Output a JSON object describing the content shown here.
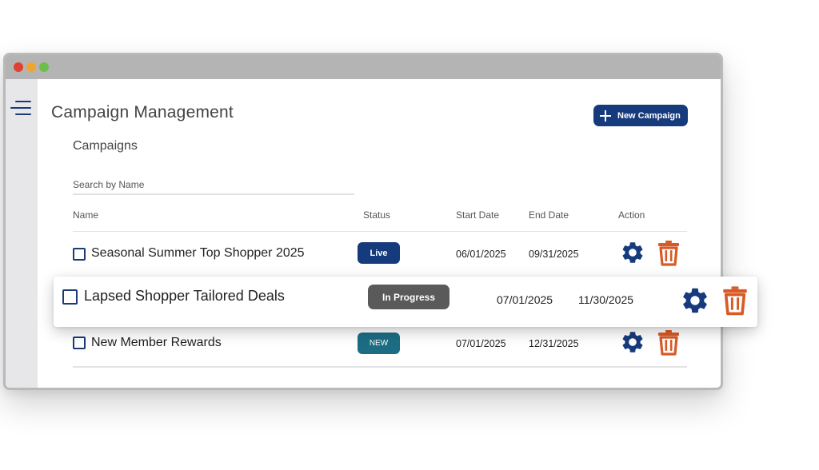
{
  "window": {
    "dots": [
      "#e0402f",
      "#f0a531",
      "#6cc04a"
    ]
  },
  "header": {
    "title": "Campaign Management",
    "new_button_label": "New Campaign"
  },
  "campaigns": {
    "section_title": "Campaigns",
    "search_placeholder": "Search by Name",
    "columns": [
      "Name",
      "Status",
      "Start Date",
      "End Date",
      "Action"
    ],
    "rows": [
      {
        "name": "Seasonal Summer Top Shopper 2025",
        "status": "Live",
        "status_color": "#163b7c",
        "start": "06/01/2025",
        "end": "09/31/2025"
      },
      {
        "name": "Lapsed Shopper Tailored Deals",
        "status": "In Progress",
        "status_color": "#5a5a5a",
        "start": "07/01/2025",
        "end": "11/30/2025"
      },
      {
        "name": "New Member Rewards",
        "status": "NEW",
        "status_color": "#1c6d84",
        "start": "07/01/2025",
        "end": "12/31/2025"
      }
    ]
  },
  "icons": {
    "menu": "hamburger-menu-icon",
    "plus": "plus-icon",
    "settings": "gear-icon",
    "delete": "trash-icon",
    "gear_color": "#163b7c",
    "trash_color": "#d85a26"
  }
}
